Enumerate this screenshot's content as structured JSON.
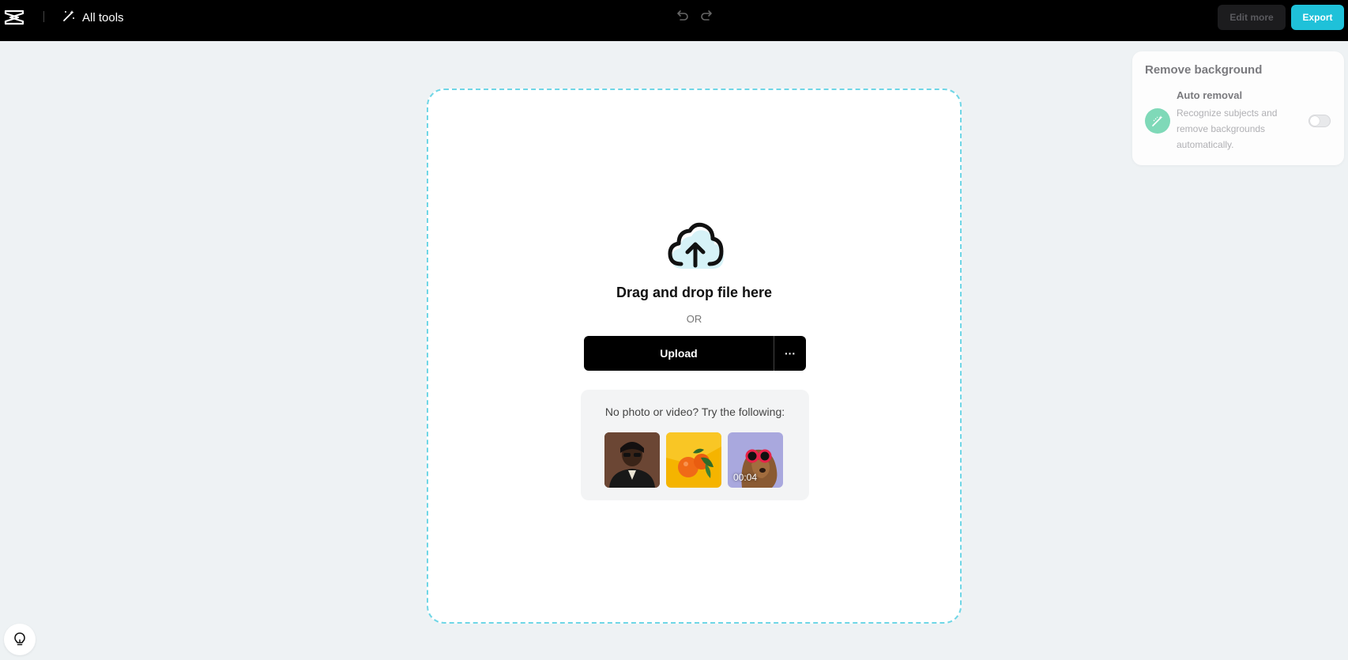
{
  "header": {
    "logo_icon": "capcut-logo-icon",
    "all_tools_label": "All tools",
    "all_tools_icon": "magic-wand-icon",
    "undo_icon": "undo-icon",
    "redo_icon": "redo-icon",
    "edit_more_label": "Edit more",
    "export_label": "Export",
    "export_color": "#1fc1d9"
  },
  "dropzone": {
    "icon": "cloud-upload-icon",
    "title": "Drag and drop file here",
    "or_text": "OR",
    "upload_label": "Upload",
    "more_label": "···",
    "border_color": "#6fd6e6",
    "samples": {
      "title": "No photo or video? Try the following:",
      "items": [
        {
          "kind": "photo",
          "subject": "person-portrait"
        },
        {
          "kind": "photo",
          "subject": "tangerines"
        },
        {
          "kind": "video",
          "subject": "dog-with-sunglasses",
          "duration": "00:04"
        }
      ]
    }
  },
  "panel": {
    "title": "Remove background",
    "auto_removal": {
      "label": "Auto removal",
      "description": "Recognize subjects and remove backgrounds automatically.",
      "icon": "auto-removal-icon",
      "enabled": false,
      "icon_color": "#7fd9b8"
    }
  },
  "help": {
    "icon": "lightbulb-icon"
  }
}
